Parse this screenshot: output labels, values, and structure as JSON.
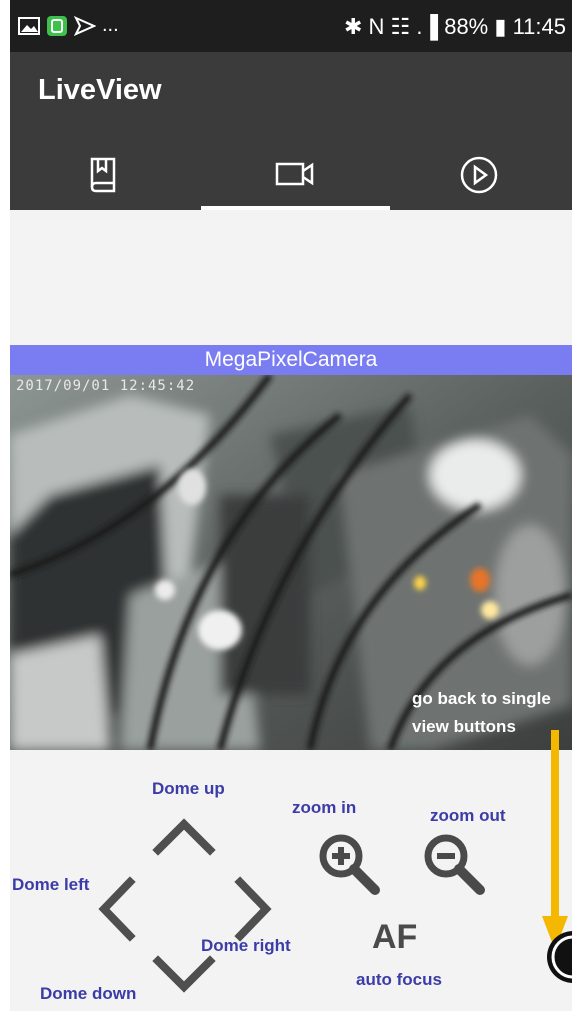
{
  "statusbar": {
    "overflow": "...",
    "right": "✱ N ☷ .▐ 88% ▮ 11:45",
    "battery": "88%",
    "time": "11:45"
  },
  "app": {
    "title": "LiveView"
  },
  "tabs": [
    {
      "name": "bookmark",
      "icon": "book-icon"
    },
    {
      "name": "live",
      "icon": "video-camera-icon",
      "active": true
    },
    {
      "name": "playback",
      "icon": "play-circle-icon"
    }
  ],
  "camera": {
    "title": "MegaPixelCamera",
    "timestamp": "2017/09/01 12:45:42"
  },
  "annotations": {
    "back_line1": "go back to single",
    "back_line2": "view buttons"
  },
  "controls": {
    "dome_up": "Dome up",
    "dome_left": "Dome left",
    "dome_right": "Dome right",
    "dome_down": "Dome down",
    "zoom_in": "zoom in",
    "zoom_out": "zoom out",
    "af": "AF",
    "auto_focus": "auto focus"
  },
  "colors": {
    "appbar": "#3b3b3b",
    "camera_title_bar": "#7a7cf2",
    "label": "#3c3ca8",
    "annotation_arrow": "#f5b800"
  }
}
